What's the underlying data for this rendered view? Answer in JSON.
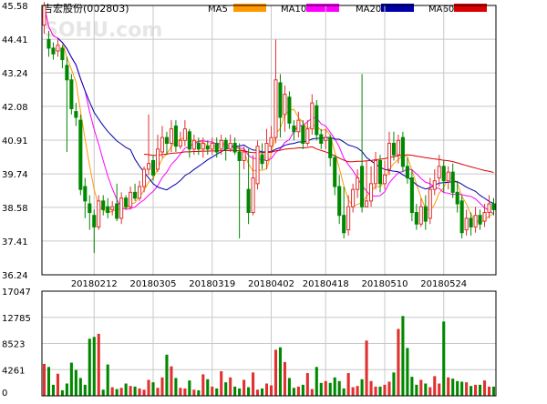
{
  "header": {
    "title": "吉宏股份(002803)",
    "watermark": "SOHU.com",
    "legend": [
      {
        "label": "MA5",
        "color": "#ff9900"
      },
      {
        "label": "MA10",
        "color": "#ff00ff"
      },
      {
        "label": "MA20",
        "color": "#0000aa"
      },
      {
        "label": "MA60",
        "color": "#dd0000"
      }
    ]
  },
  "colors": {
    "up": "#e03030",
    "down": "#008800",
    "grid": "#c8c8c8",
    "axis": "#000000",
    "background": "#ffffff"
  },
  "chart_data": [
    {
      "type": "candlestick",
      "y_ticks": [
        "45.58",
        "44.41",
        "43.24",
        "42.08",
        "40.91",
        "39.74",
        "38.58",
        "37.41",
        "36.24"
      ],
      "ylim": [
        36.24,
        45.58
      ],
      "x_tick_labels": [
        "20180212",
        "20180305",
        "20180319",
        "20180402",
        "20180418",
        "20180510",
        "20180524"
      ],
      "x_tick_index": [
        11,
        24,
        37,
        50,
        62,
        75,
        88
      ],
      "candles": [
        {
          "o": 44.9,
          "c": 45.58,
          "h": 45.7,
          "l": 44.6
        },
        {
          "o": 44.4,
          "c": 44.1,
          "h": 44.7,
          "l": 43.8
        },
        {
          "o": 44.1,
          "c": 43.9,
          "h": 44.3,
          "l": 43.7
        },
        {
          "o": 44.0,
          "c": 44.2,
          "h": 44.4,
          "l": 43.8
        },
        {
          "o": 44.1,
          "c": 43.7,
          "h": 44.2,
          "l": 43.4
        },
        {
          "o": 43.5,
          "c": 43.0,
          "h": 43.8,
          "l": 40.5
        },
        {
          "o": 43.0,
          "c": 42.0,
          "h": 43.2,
          "l": 41.8
        },
        {
          "o": 41.9,
          "c": 41.7,
          "h": 42.2,
          "l": 41.4
        },
        {
          "o": 41.6,
          "c": 39.2,
          "h": 41.8,
          "l": 39.0
        },
        {
          "o": 39.3,
          "c": 38.8,
          "h": 39.6,
          "l": 38.2
        },
        {
          "o": 38.7,
          "c": 38.4,
          "h": 39.0,
          "l": 37.8
        },
        {
          "o": 38.3,
          "c": 37.9,
          "h": 38.5,
          "l": 37.0
        },
        {
          "o": 37.9,
          "c": 38.8,
          "h": 39.0,
          "l": 37.8
        },
        {
          "o": 38.8,
          "c": 38.5,
          "h": 39.0,
          "l": 38.3
        },
        {
          "o": 38.6,
          "c": 38.4,
          "h": 38.9,
          "l": 38.2
        },
        {
          "o": 38.5,
          "c": 38.6,
          "h": 38.8,
          "l": 38.3
        },
        {
          "o": 38.7,
          "c": 38.2,
          "h": 39.4,
          "l": 38.1
        },
        {
          "o": 38.2,
          "c": 38.9,
          "h": 39.1,
          "l": 38.0
        },
        {
          "o": 38.9,
          "c": 38.6,
          "h": 39.0,
          "l": 38.5
        },
        {
          "o": 38.6,
          "c": 39.1,
          "h": 39.3,
          "l": 38.5
        },
        {
          "o": 39.1,
          "c": 38.9,
          "h": 39.4,
          "l": 38.8
        },
        {
          "o": 38.9,
          "c": 39.3,
          "h": 39.5,
          "l": 38.8
        },
        {
          "o": 39.3,
          "c": 39.9,
          "h": 40.0,
          "l": 39.1
        },
        {
          "o": 39.9,
          "c": 40.1,
          "h": 41.8,
          "l": 39.7
        },
        {
          "o": 40.2,
          "c": 39.7,
          "h": 40.4,
          "l": 39.5
        },
        {
          "o": 39.9,
          "c": 40.6,
          "h": 41.1,
          "l": 39.8
        },
        {
          "o": 40.5,
          "c": 41.0,
          "h": 41.4,
          "l": 40.3
        },
        {
          "o": 41.0,
          "c": 40.8,
          "h": 41.2,
          "l": 40.4
        },
        {
          "o": 40.8,
          "c": 41.3,
          "h": 41.6,
          "l": 40.5
        },
        {
          "o": 41.4,
          "c": 40.7,
          "h": 41.6,
          "l": 40.5
        },
        {
          "o": 40.7,
          "c": 40.9,
          "h": 41.2,
          "l": 40.6
        },
        {
          "o": 40.9,
          "c": 41.3,
          "h": 41.6,
          "l": 40.7
        },
        {
          "o": 41.2,
          "c": 40.6,
          "h": 41.3,
          "l": 40.3
        },
        {
          "o": 40.6,
          "c": 40.9,
          "h": 41.1,
          "l": 40.4
        },
        {
          "o": 40.8,
          "c": 40.6,
          "h": 41.0,
          "l": 40.4
        },
        {
          "o": 40.6,
          "c": 40.8,
          "h": 41.0,
          "l": 40.3
        },
        {
          "o": 40.7,
          "c": 40.6,
          "h": 40.9,
          "l": 40.4
        },
        {
          "o": 40.6,
          "c": 40.8,
          "h": 41.0,
          "l": 40.4
        },
        {
          "o": 40.8,
          "c": 40.5,
          "h": 41.0,
          "l": 40.3
        },
        {
          "o": 40.6,
          "c": 40.9,
          "h": 41.1,
          "l": 40.4
        },
        {
          "o": 40.9,
          "c": 40.6,
          "h": 41.0,
          "l": 40.2
        },
        {
          "o": 40.6,
          "c": 40.8,
          "h": 41.1,
          "l": 40.5
        },
        {
          "o": 40.8,
          "c": 40.5,
          "h": 41.0,
          "l": 40.4
        },
        {
          "o": 40.5,
          "c": 40.2,
          "h": 40.8,
          "l": 37.5
        },
        {
          "o": 40.2,
          "c": 40.5,
          "h": 40.7,
          "l": 39.9
        },
        {
          "o": 39.2,
          "c": 38.4,
          "h": 40.6,
          "l": 38.0
        },
        {
          "o": 38.4,
          "c": 39.6,
          "h": 40.4,
          "l": 38.3
        },
        {
          "o": 39.4,
          "c": 40.7,
          "h": 40.9,
          "l": 39.2
        },
        {
          "o": 40.4,
          "c": 40.1,
          "h": 40.8,
          "l": 39.9
        },
        {
          "o": 40.2,
          "c": 40.8,
          "h": 41.3,
          "l": 39.9
        },
        {
          "o": 40.7,
          "c": 41.0,
          "h": 41.4,
          "l": 40.5
        },
        {
          "o": 41.0,
          "c": 43.0,
          "h": 44.4,
          "l": 40.8
        },
        {
          "o": 42.9,
          "c": 41.7,
          "h": 43.2,
          "l": 41.0
        },
        {
          "o": 41.8,
          "c": 42.5,
          "h": 42.8,
          "l": 41.2
        },
        {
          "o": 42.4,
          "c": 41.5,
          "h": 42.6,
          "l": 41.3
        },
        {
          "o": 41.4,
          "c": 41.2,
          "h": 41.6,
          "l": 40.9
        },
        {
          "o": 41.2,
          "c": 41.6,
          "h": 41.9,
          "l": 41.0
        },
        {
          "o": 41.4,
          "c": 40.8,
          "h": 41.6,
          "l": 40.6
        },
        {
          "o": 40.8,
          "c": 41.3,
          "h": 41.6,
          "l": 40.7
        },
        {
          "o": 41.3,
          "c": 42.2,
          "h": 42.5,
          "l": 41.1
        },
        {
          "o": 42.1,
          "c": 41.1,
          "h": 42.3,
          "l": 40.9
        },
        {
          "o": 41.1,
          "c": 40.8,
          "h": 41.3,
          "l": 40.6
        },
        {
          "o": 40.9,
          "c": 41.0,
          "h": 41.3,
          "l": 40.6
        },
        {
          "o": 41.0,
          "c": 40.3,
          "h": 41.1,
          "l": 40.0
        },
        {
          "o": 40.3,
          "c": 39.3,
          "h": 40.4,
          "l": 39.0
        },
        {
          "o": 39.3,
          "c": 38.3,
          "h": 39.7,
          "l": 38.0
        },
        {
          "o": 38.3,
          "c": 37.7,
          "h": 39.3,
          "l": 37.5
        },
        {
          "o": 37.8,
          "c": 38.6,
          "h": 39.0,
          "l": 37.6
        },
        {
          "o": 38.6,
          "c": 39.2,
          "h": 39.4,
          "l": 38.4
        },
        {
          "o": 39.2,
          "c": 39.6,
          "h": 39.9,
          "l": 38.9
        },
        {
          "o": 40.0,
          "c": 38.6,
          "h": 43.2,
          "l": 38.4
        },
        {
          "o": 38.6,
          "c": 38.8,
          "h": 40.2,
          "l": 38.6
        },
        {
          "o": 38.8,
          "c": 39.4,
          "h": 40.0,
          "l": 38.6
        },
        {
          "o": 39.4,
          "c": 40.2,
          "h": 40.5,
          "l": 39.2
        },
        {
          "o": 40.2,
          "c": 39.4,
          "h": 40.4,
          "l": 39.1
        },
        {
          "o": 39.4,
          "c": 39.7,
          "h": 40.2,
          "l": 39.2
        },
        {
          "o": 39.9,
          "c": 40.8,
          "h": 41.2,
          "l": 39.7
        },
        {
          "o": 40.8,
          "c": 40.4,
          "h": 41.2,
          "l": 40.2
        },
        {
          "o": 40.4,
          "c": 40.9,
          "h": 41.1,
          "l": 40.1
        },
        {
          "o": 41.0,
          "c": 40.0,
          "h": 41.2,
          "l": 39.8
        },
        {
          "o": 40.0,
          "c": 39.6,
          "h": 40.3,
          "l": 39.4
        },
        {
          "o": 39.6,
          "c": 38.4,
          "h": 39.9,
          "l": 38.1
        },
        {
          "o": 38.4,
          "c": 38.0,
          "h": 38.7,
          "l": 37.8
        },
        {
          "o": 38.0,
          "c": 38.6,
          "h": 38.9,
          "l": 37.9
        },
        {
          "o": 38.6,
          "c": 38.1,
          "h": 39.0,
          "l": 37.8
        },
        {
          "o": 38.2,
          "c": 39.2,
          "h": 39.6,
          "l": 38.0
        },
        {
          "o": 39.2,
          "c": 39.5,
          "h": 39.9,
          "l": 39.0
        },
        {
          "o": 39.6,
          "c": 40.0,
          "h": 40.4,
          "l": 39.3
        },
        {
          "o": 40.0,
          "c": 39.5,
          "h": 40.2,
          "l": 39.1
        },
        {
          "o": 39.5,
          "c": 39.8,
          "h": 40.0,
          "l": 39.2
        },
        {
          "o": 39.8,
          "c": 39.1,
          "h": 40.1,
          "l": 38.9
        },
        {
          "o": 39.1,
          "c": 38.7,
          "h": 39.5,
          "l": 38.4
        },
        {
          "o": 38.8,
          "c": 37.7,
          "h": 39.0,
          "l": 37.5
        },
        {
          "o": 37.8,
          "c": 38.2,
          "h": 38.5,
          "l": 37.6
        },
        {
          "o": 38.2,
          "c": 37.9,
          "h": 38.4,
          "l": 37.6
        },
        {
          "o": 37.9,
          "c": 38.3,
          "h": 38.6,
          "l": 37.7
        },
        {
          "o": 38.3,
          "c": 38.0,
          "h": 38.5,
          "l": 37.8
        },
        {
          "o": 38.1,
          "c": 38.4,
          "h": 38.7,
          "l": 37.9
        },
        {
          "o": 38.4,
          "c": 38.7,
          "h": 39.0,
          "l": 38.2
        },
        {
          "o": 38.7,
          "c": 38.5,
          "h": 38.9,
          "l": 38.3
        }
      ]
    },
    {
      "type": "bar",
      "y_ticks": [
        "17047",
        "12785",
        "8523",
        "4261",
        "0"
      ],
      "ylim": [
        0,
        17047
      ],
      "values": [
        5200,
        4700,
        1800,
        3600,
        900,
        2000,
        5400,
        4200,
        2900,
        1800,
        9300,
        9600,
        10100,
        1000,
        5100,
        1400,
        1100,
        1300,
        2000,
        1600,
        1500,
        1200,
        1000,
        2600,
        2200,
        1300,
        3000,
        6700,
        4800,
        2900,
        1300,
        1200,
        2500,
        1000,
        900,
        3500,
        2700,
        1500,
        1200,
        4000,
        2200,
        3000,
        1500,
        1200,
        2600,
        1400,
        3800,
        1000,
        1200,
        2000,
        1700,
        7500,
        7900,
        5500,
        2900,
        1300,
        1500,
        1800,
        3700,
        1100,
        4700,
        2100,
        2400,
        2100,
        3000,
        2400,
        1200,
        3700,
        1400,
        1600,
        2700,
        9000,
        2400,
        1500,
        1500,
        1800,
        2300,
        3800,
        10900,
        13000,
        7800,
        3100,
        1800,
        2600,
        2000,
        1400,
        3200,
        2000,
        12100,
        3000,
        2800,
        2400,
        2300,
        2200,
        1600,
        1800,
        1800,
        2500,
        1500,
        1500
      ]
    }
  ]
}
